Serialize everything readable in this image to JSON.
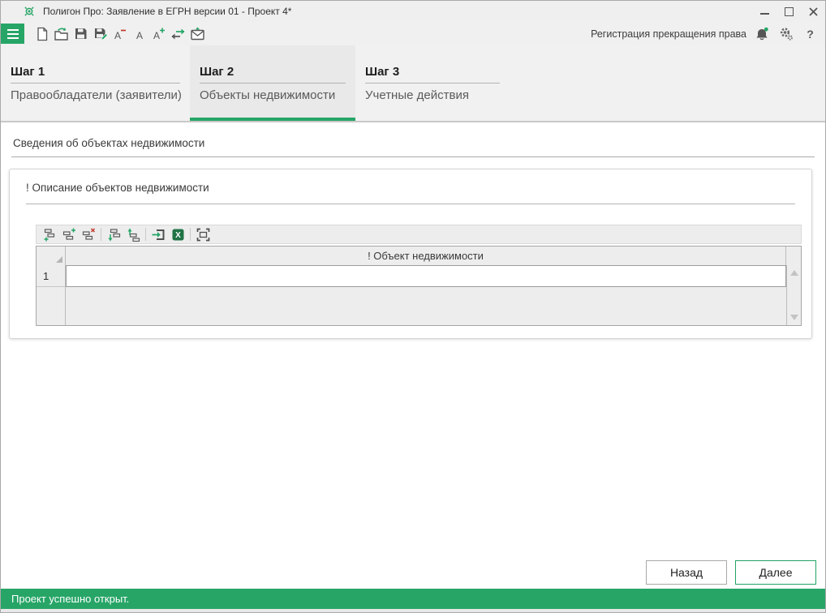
{
  "colors": {
    "accent": "#27a567",
    "excel_green": "#217346",
    "danger_red": "#c0392b",
    "status_bg": "#27a567"
  },
  "titlebar": {
    "title": "Полигон Про: Заявление в ЕГРН версии 01 - Проект 4*"
  },
  "toolbar": {
    "mode_label": "Регистрация прекращения права",
    "help_label": "?"
  },
  "tabs": [
    {
      "step": "Шаг 1",
      "label": "Правообладатели (заявители)",
      "active": false
    },
    {
      "step": "Шаг 2",
      "label": "Объекты недвижимости",
      "active": true
    },
    {
      "step": "Шаг 3",
      "label": "Учетные действия",
      "active": false
    }
  ],
  "content": {
    "section_title": "Сведения об объектах недвижимости",
    "panel_title": "! Описание объектов недвижимости",
    "table": {
      "header": "! Объект недвижимости",
      "rows": [
        {
          "num": "1",
          "value": ""
        }
      ]
    }
  },
  "footer": {
    "back": "Назад",
    "next": "Далее"
  },
  "statusbar": {
    "message": "Проект успешно открыт."
  }
}
